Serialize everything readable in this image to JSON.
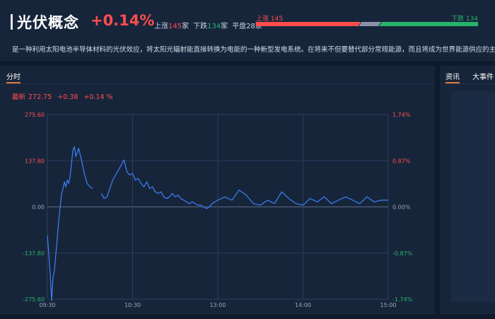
{
  "header": {
    "title": "光伏概念",
    "change_pct": "+0.14%",
    "up_label": "上涨",
    "up_count": "145",
    "up_unit": "家",
    "down_label": "下跌",
    "down_count": "134",
    "down_unit": "家",
    "flat_label": "平盘",
    "flat_count": "28",
    "flat_unit": "家",
    "bar_up_label": "上涨 145",
    "bar_down_label": "下跌 134",
    "breadth": {
      "up": 145,
      "flat": 28,
      "down": 134
    },
    "colors": {
      "up": "#ff4d4d",
      "down": "#27b36a",
      "flat": "#8a93a6"
    },
    "description": "是一种利用太阳电池半导体材料的光伏效应，将太阳光辐射能直接转换为电能的一种新型发电系统。在将来不但要替代部分常规能源，而且将成为世界能源供应的主体。"
  },
  "main": {
    "tab_label": "分时",
    "quote": {
      "last_label": "最新",
      "last_value": "272.75",
      "change": "+0.38",
      "change_pct": "+0.14 %"
    }
  },
  "side": {
    "tabs": [
      "资讯",
      "大事件"
    ]
  },
  "chart_data": {
    "type": "line",
    "title": "",
    "xlabel": "",
    "ylabel": "",
    "x_ticks": [
      "09:30",
      "10:30",
      "13:00",
      "14:00",
      "15:00"
    ],
    "y_ticks_left": [
      "275.60",
      "137.80",
      "0.00",
      "-137.80",
      "-275.60"
    ],
    "y_ticks_right": [
      "1.74%",
      "0.87%",
      "0.00%",
      "-0.87%",
      "-1.74%"
    ],
    "ylim": [
      -275.6,
      275.6
    ],
    "x_range_minutes": [
      0,
      240
    ],
    "grid": true,
    "line_color": "#3b82f6",
    "series": [
      {
        "x": [
          0,
          1,
          2,
          3,
          4,
          5,
          6,
          7,
          8,
          9,
          10,
          11,
          12,
          13,
          14,
          15,
          16,
          17,
          18,
          19,
          20,
          22,
          24,
          26,
          28,
          30,
          32,
          34,
          36,
          38,
          40,
          42,
          44,
          46,
          48,
          50,
          52,
          54,
          56,
          58,
          60,
          62,
          64,
          66,
          68,
          70,
          72,
          74,
          76,
          78,
          80,
          82,
          84,
          86,
          88,
          90,
          92,
          94,
          96,
          98,
          100,
          102,
          104,
          106,
          108,
          110,
          112,
          114,
          116,
          118,
          120,
          125,
          130,
          135,
          140,
          145,
          150,
          155,
          160,
          165,
          170,
          175,
          180,
          185,
          190,
          195,
          200,
          205,
          210,
          215,
          220,
          225,
          230,
          235,
          240
        ],
        "y": [
          -85,
          -140,
          -200,
          -280,
          -210,
          -190,
          -140,
          -90,
          -40,
          0,
          40,
          55,
          75,
          60,
          80,
          70,
          90,
          130,
          170,
          180,
          150,
          175,
          140,
          100,
          70,
          60,
          55,
          null,
          null,
          40,
          25,
          30,
          55,
          80,
          95,
          110,
          125,
          140,
          105,
          95,
          100,
          80,
          85,
          70,
          60,
          75,
          55,
          60,
          45,
          40,
          45,
          30,
          25,
          30,
          40,
          30,
          35,
          25,
          20,
          15,
          10,
          15,
          10,
          5,
          5,
          0,
          -5,
          0,
          10,
          15,
          20,
          30,
          20,
          50,
          35,
          10,
          5,
          20,
          10,
          45,
          25,
          10,
          5,
          25,
          15,
          30,
          10,
          20,
          30,
          20,
          10,
          30,
          15,
          20,
          20
        ]
      }
    ],
    "gap": {
      "start": 27,
      "end": 37
    }
  }
}
